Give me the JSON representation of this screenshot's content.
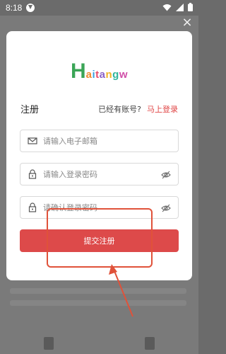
{
  "status_bar": {
    "time": "8:18",
    "icons": [
      "download-icon",
      "wifi-icon",
      "signal-icon",
      "battery-icon"
    ]
  },
  "dialog": {
    "close_symbol": "×",
    "logo": {
      "first_letter": "H",
      "rest": "aitangw"
    },
    "title": "注册",
    "have_account_text": "已经有账号?",
    "login_link": "马上登录",
    "fields": {
      "email": {
        "placeholder": "请输入电子邮箱",
        "value": "",
        "icon": "mail-icon"
      },
      "password": {
        "placeholder": "请输入登录密码",
        "value": "",
        "icon": "lock-icon"
      },
      "confirm_password": {
        "placeholder": "请确认登录密码",
        "value": "",
        "icon": "lock-icon"
      }
    },
    "submit_label": "提交注册"
  },
  "colors": {
    "accent_red": "#dd4a4a",
    "logo_green": "#3ba557",
    "annotation": "#e0523a"
  }
}
